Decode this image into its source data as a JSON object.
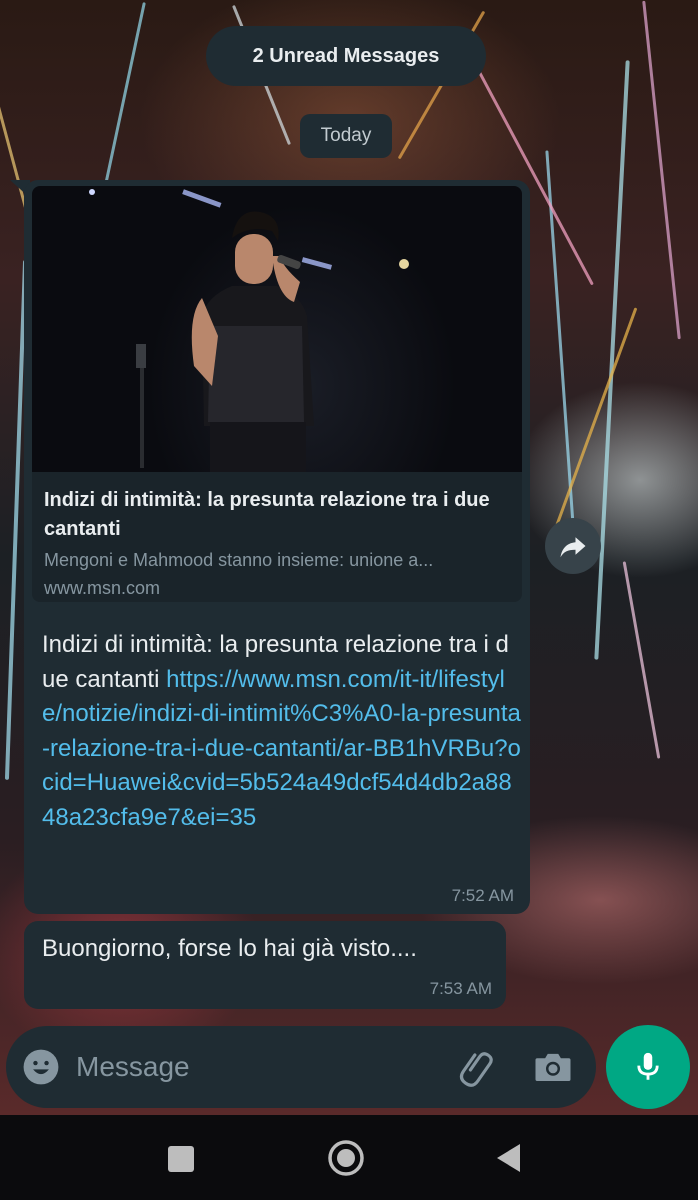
{
  "chat": {
    "unread_banner": "2 Unread Messages",
    "date_divider": "Today",
    "messages": [
      {
        "link_preview": {
          "title": "Indizi di intimità: la presunta relazione tra i due cantanti",
          "description": "Mengoni e Mahmood stanno insieme: unione a...",
          "domain": "www.msn.com"
        },
        "text": "Indizi di intimità: la presunta relazione tra i due cantanti ",
        "link": "https://www.msn.com/it-it/lifestyle/notizie/indizi-di-intimit%C3%A0-la-presunta-relazione-tra-i-due-cantanti/ar-BB1hVRBu?ocid=Huawei&cvid=5b524a49dcf54d4db2a8848a23cfa9e7&ei=35",
        "time": "7:52 AM"
      },
      {
        "text": "Buongiorno, forse lo hai già visto....",
        "time": "7:53 AM"
      }
    ]
  },
  "composer": {
    "placeholder": "Message",
    "value": ""
  },
  "icons": {
    "forward": "forward-icon",
    "emoji": "emoji-icon",
    "attach": "paperclip-icon",
    "camera": "camera-icon",
    "mic": "microphone-icon",
    "nav_recents": "recents-square-icon",
    "nav_home": "home-circle-icon",
    "nav_back": "back-triangle-icon"
  },
  "colors": {
    "bubble": "#1f2c33",
    "link": "#53bdeb",
    "accent": "#00a884",
    "meta_text": "#8696a0"
  }
}
